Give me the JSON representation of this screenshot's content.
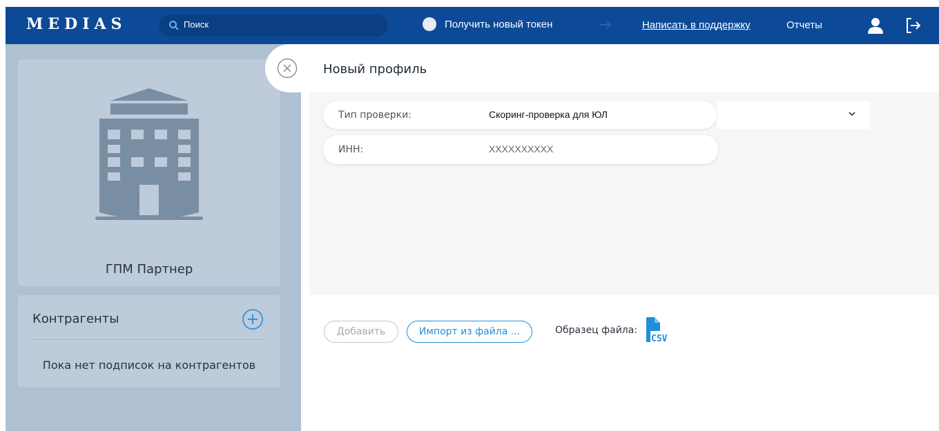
{
  "header": {
    "logo": "MEDIAS",
    "search_placeholder": "Поиск",
    "token_label": "Получить новый токен",
    "support_link": "Написать в поддержку",
    "reports_link": "Отчеты",
    "icons": [
      "search-icon",
      "token-status-icon",
      "arrow-icon",
      "user-icon",
      "logout-icon"
    ]
  },
  "sidebar": {
    "company": {
      "name": "ГПМ Партнер",
      "icon": "building-icon"
    },
    "contractors": {
      "title": "Контрагенты",
      "empty_text": "Пока нет подписок на контрагентов",
      "add_icon": "plus-circle-icon"
    }
  },
  "panel": {
    "title": "Новый профиль",
    "close_icon": "close-circle-icon",
    "check_type": {
      "label": "Тип проверки:",
      "value": "Скоринг-проверка для ЮЛ"
    },
    "inn": {
      "label": "ИНН:",
      "placeholder": "XXXXXXXXXX"
    },
    "add_button": "Добавить",
    "import_button": "Импорт из файла ...",
    "sample_label": "Образец файла:",
    "sample_file": "CSV"
  },
  "colors": {
    "header_bg": "#0c4a97",
    "sidebar_bg": "#b0c0d3",
    "card_bg": "#bdcbdb",
    "accent": "#1f8fd9",
    "building": "#7a8ea3"
  }
}
